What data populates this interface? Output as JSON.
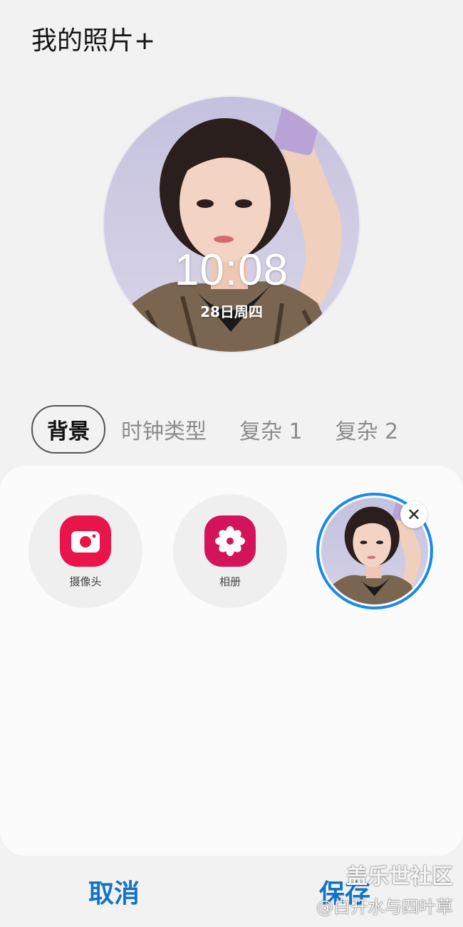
{
  "header": {
    "title": "我的照片+"
  },
  "preview": {
    "time": "10:08",
    "date": "28日周四"
  },
  "tabs": [
    {
      "label": "背景",
      "active": true
    },
    {
      "label": "时钟类型",
      "active": false
    },
    {
      "label": "复杂 1",
      "active": false
    },
    {
      "label": "复杂 2",
      "active": false
    }
  ],
  "options": {
    "camera_label": "摄像头",
    "gallery_label": "相册",
    "remove_icon": "✕"
  },
  "actions": {
    "cancel_label": "取消",
    "save_label": "保存"
  },
  "watermark": {
    "line1": "盖乐世社区",
    "line2": "@白开水与四叶草"
  },
  "colors": {
    "accent": "#1573c4",
    "selection_ring": "#1a8ae6",
    "camera_icon": "#e8144a",
    "gallery_icon": "#d4145a"
  }
}
